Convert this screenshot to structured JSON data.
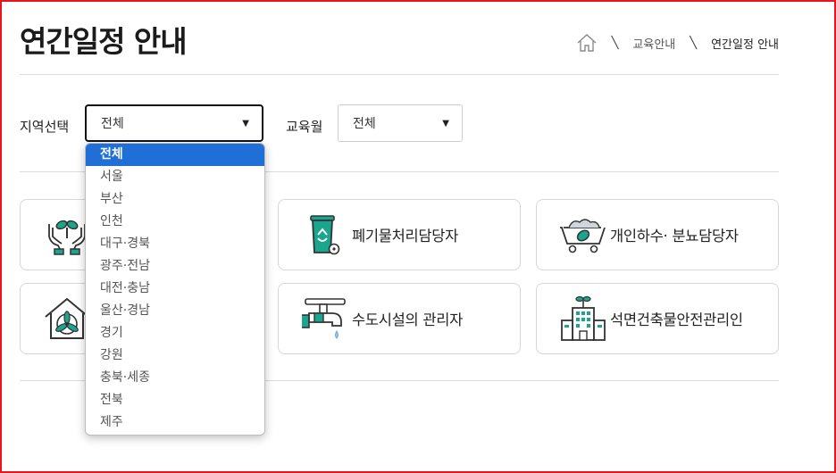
{
  "header": {
    "title": "연간일정 안내",
    "breadcrumb": [
      "교육안내",
      "연간일정 안내"
    ]
  },
  "filters": {
    "region_label": "지역선택",
    "region_value": "전체",
    "month_label": "교육월",
    "month_value": "전체"
  },
  "region_options": [
    "전체",
    "서울",
    "부산",
    "인천",
    "대구·경북",
    "광주·전남",
    "대전·충남",
    "울산·경남",
    "경기",
    "강원",
    "충북·세종",
    "전북",
    "제주"
  ],
  "cards": [
    {
      "label": "",
      "icon": "hands-plant-icon"
    },
    {
      "label": "폐기물처리담당자",
      "icon": "recycle-bin-icon"
    },
    {
      "label": "개인하수· 분뇨담당자",
      "icon": "cart-leaf-icon"
    },
    {
      "label": "",
      "icon": "house-fan-icon"
    },
    {
      "label": "수도시설의 관리자",
      "icon": "water-tap-icon"
    },
    {
      "label": "석면건축물안전관리인",
      "icon": "building-icon"
    }
  ],
  "colors": {
    "accent": "#1f6fd6",
    "teal": "#1aa58e",
    "frame": "#e8151c"
  }
}
